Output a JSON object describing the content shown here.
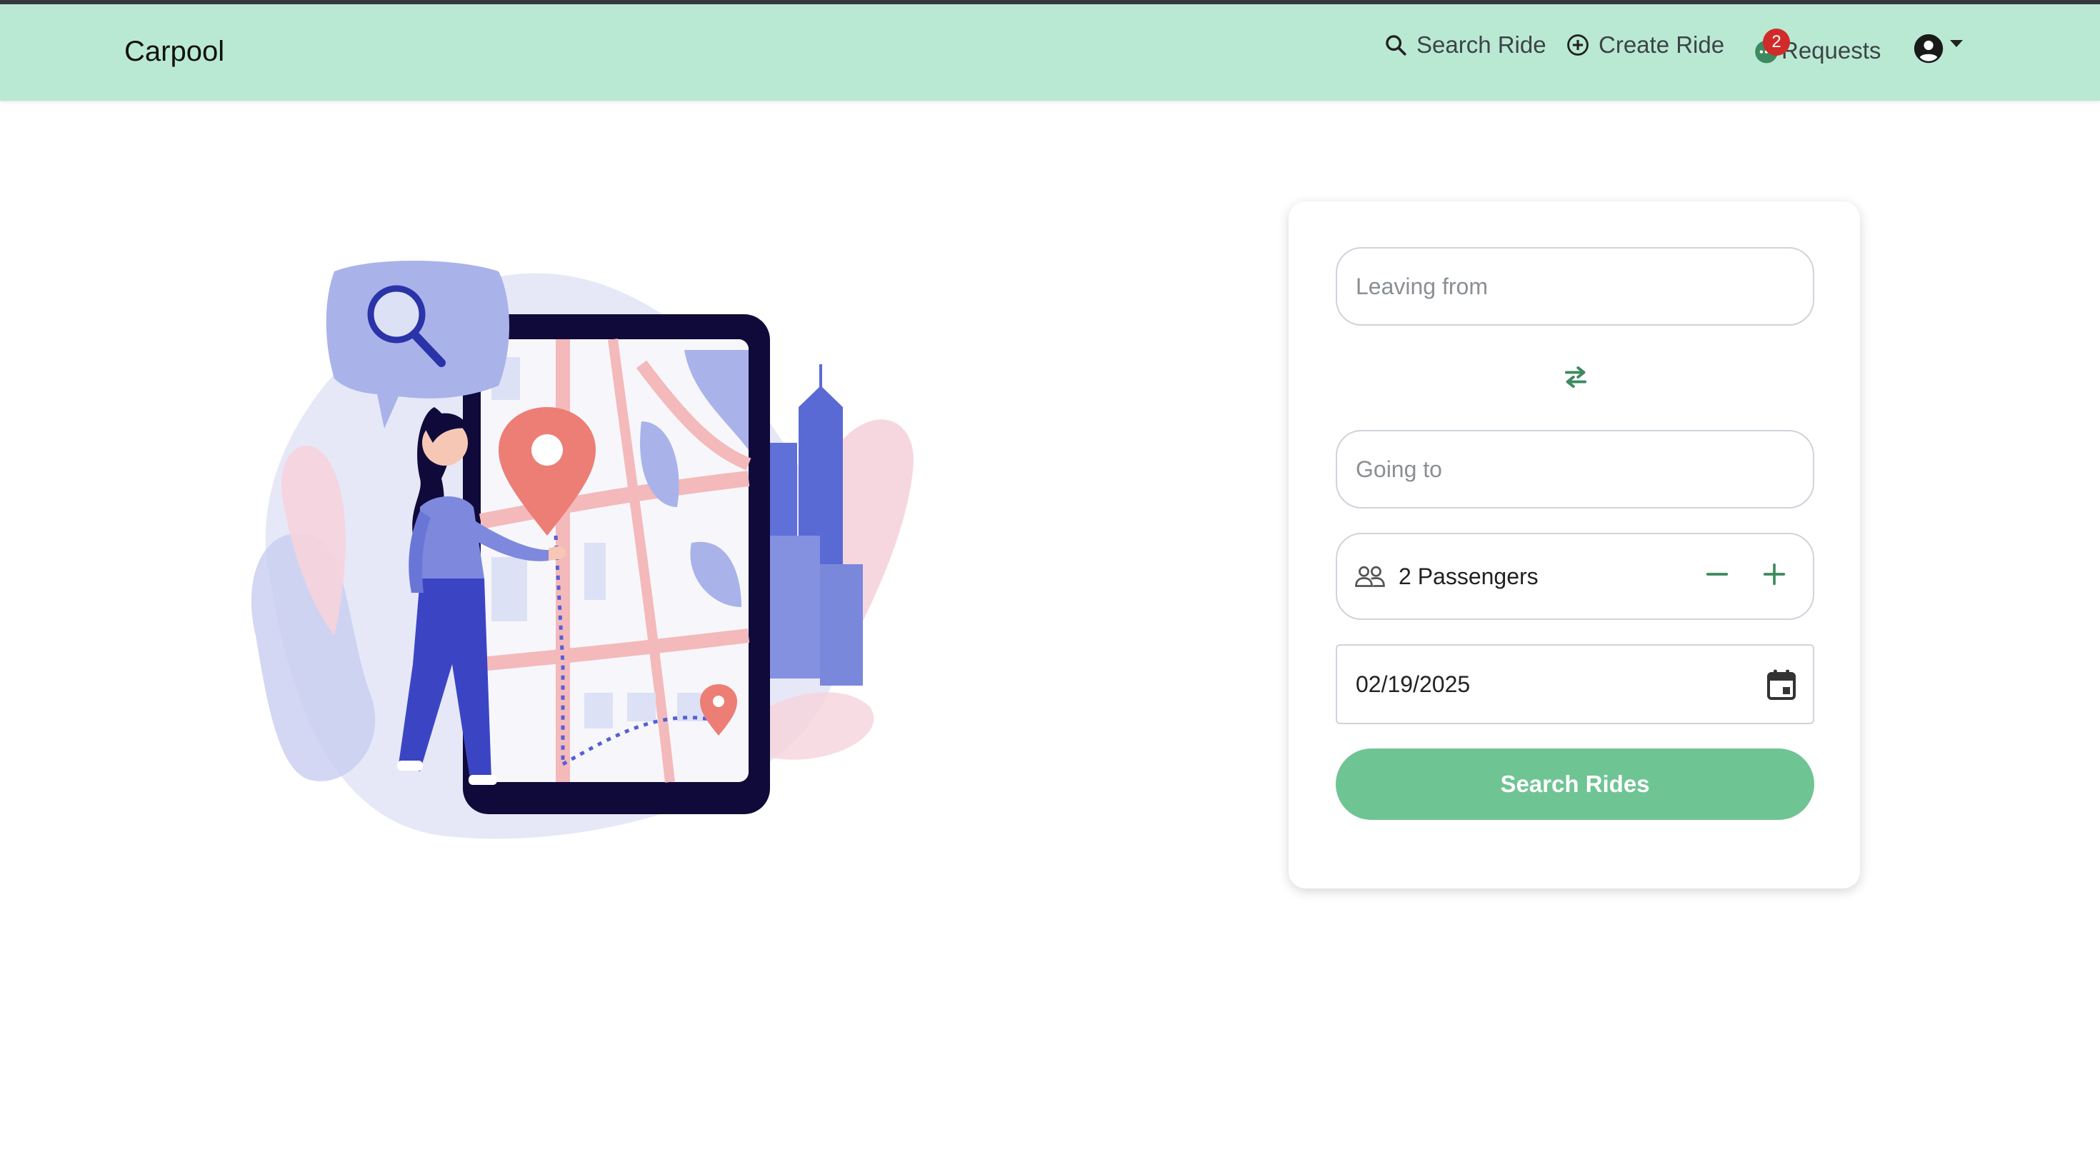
{
  "navbar": {
    "brand": "Carpool",
    "search_ride_label": "Search Ride",
    "create_ride_label": "Create Ride",
    "requests_label": "Requests",
    "requests_badge": "2"
  },
  "form": {
    "leaving_placeholder": "Leaving from",
    "going_placeholder": "Going to",
    "passengers_label": "2 Passengers",
    "date_value": "02/19/2025",
    "submit_label": "Search Rides"
  },
  "colors": {
    "navbar_bg": "#bae9d3",
    "accent": "#6fc494",
    "badge": "#d12a2a",
    "icon_green": "#3d8a5f"
  }
}
